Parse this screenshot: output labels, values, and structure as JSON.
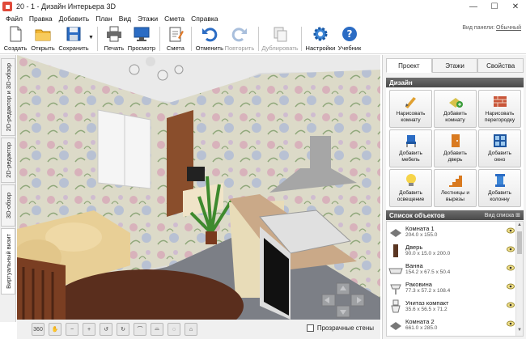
{
  "window": {
    "title": "20 - 1 - Дизайн Интерьера 3D",
    "minimize": "—",
    "maximize": "☐",
    "close": "✕"
  },
  "menu": [
    "Файл",
    "Правка",
    "Добавить",
    "План",
    "Вид",
    "Этажи",
    "Смета",
    "Справка"
  ],
  "toolbar": {
    "create": "Создать",
    "open": "Открыть",
    "save": "Сохранить",
    "print": "Печать",
    "preview": "Просмотр",
    "estimate": "Смета",
    "undo": "Отменить",
    "redo": "Повторить",
    "duplicate": "Дублировать",
    "settings": "Настройки",
    "tutorial": "Учебник",
    "panel_view_label": "Вид панели:",
    "panel_view_value": "Обычный"
  },
  "left_tabs": [
    "2D-редактор и 3D-обзор",
    "2D-редактор",
    "3D-обзор",
    "Виртуальный визит"
  ],
  "bottom": {
    "zoom_360": "360",
    "transparent_walls": "Прозрачные стены"
  },
  "right_panel": {
    "tabs": [
      "Проект",
      "Этажи",
      "Свойства"
    ],
    "design_header": "Дизайн",
    "design_buttons": [
      [
        "Нарисовать",
        "комнату"
      ],
      [
        "Добавить",
        "комнату"
      ],
      [
        "Нарисовать",
        "перегородку"
      ],
      [
        "Добавить",
        "мебель"
      ],
      [
        "Добавить",
        "дверь"
      ],
      [
        "Добавить",
        "окно"
      ],
      [
        "Добавить",
        "освещение"
      ],
      [
        "Лестницы и",
        "вырезы"
      ],
      [
        "Добавить",
        "колонну"
      ]
    ],
    "objects_header": "Список объектов",
    "objects_view": "Вид списка",
    "objects": [
      {
        "name": "Комната 1",
        "dims": "204.0 x 155.0"
      },
      {
        "name": "Дверь",
        "dims": "90.0 x 15.0 x 200.0"
      },
      {
        "name": "Ванна",
        "dims": "154.2 x 67.5 x 50.4"
      },
      {
        "name": "Раковина",
        "dims": "77.3 x 57.2 x 108.4"
      },
      {
        "name": "Унитаз компакт",
        "dims": "35.6 x 56.5 x 71.2"
      },
      {
        "name": "Комната 2",
        "dims": "661.0 x 285.0"
      }
    ]
  },
  "colors": {
    "accent_blue": "#2b6cc4",
    "header_gray": "#555555",
    "wall_floral": "#d9d8c4",
    "floor": "#7c7f86",
    "sofa": "#e8cf96",
    "table": "#5a2e1d"
  }
}
